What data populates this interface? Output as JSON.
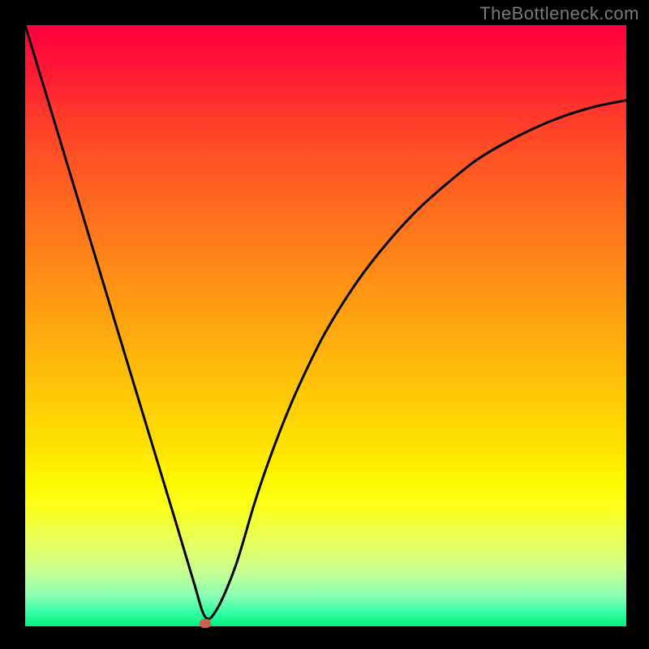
{
  "watermark": "TheBottleneck.com",
  "colors": {
    "frame": "#000000",
    "curve": "#000000",
    "marker": "#c86050",
    "gradient_top": "#ff003e",
    "gradient_bottom": "#00f07a"
  },
  "chart_data": {
    "type": "line",
    "title": "",
    "xlabel": "",
    "ylabel": "",
    "xlim": [
      0,
      100
    ],
    "ylim": [
      0,
      100
    ],
    "grid": false,
    "series": [
      {
        "name": "bottleneck-curve",
        "x": [
          0,
          5,
          10,
          15,
          20,
          25,
          28,
          30,
          32,
          35,
          38,
          40,
          43,
          46,
          50,
          55,
          60,
          65,
          70,
          75,
          80,
          85,
          90,
          95,
          100
        ],
        "values": [
          100,
          83.5,
          67,
          50.5,
          34,
          17.5,
          7.5,
          1.5,
          3,
          10,
          20,
          26,
          34,
          41,
          49,
          57,
          63.5,
          69,
          73.5,
          77.5,
          80.5,
          83,
          85,
          86.5,
          87.5
        ]
      }
    ],
    "annotations": [
      {
        "name": "minimum",
        "x": 30,
        "y": 0.5
      }
    ]
  }
}
